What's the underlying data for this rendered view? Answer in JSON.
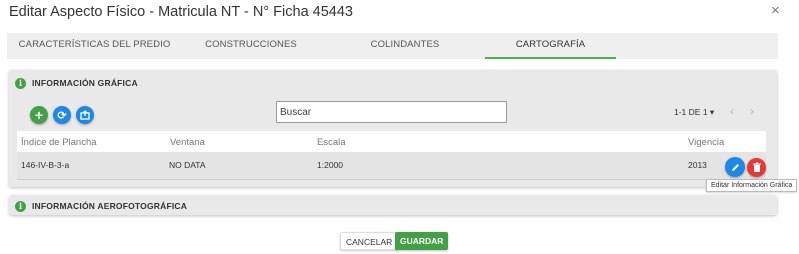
{
  "dialog": {
    "title": "Editar Aspecto Físico - Matricula NT - N° Ficha 45443",
    "close_icon": "×"
  },
  "tabs": [
    {
      "label": "Características del Predio",
      "active": false
    },
    {
      "label": "Construcciones",
      "active": false
    },
    {
      "label": "Colindantes",
      "active": false
    },
    {
      "label": "Cartografía",
      "active": true
    }
  ],
  "info_grafica": {
    "title": "INFORMACIÓN GRÁFICA",
    "info_icon": "i",
    "actions": {
      "add_icon": "+",
      "refresh_icon": "⟳",
      "upload_icon": "upload-icon"
    },
    "search": {
      "placeholder": "Buscar",
      "value": ""
    },
    "pagination": {
      "text": "1-1 DE 1",
      "dropdown_icon": "▾",
      "prev_icon": "‹",
      "next_icon": "›"
    },
    "columns": [
      "Índice de Plancha",
      "Ventana",
      "Escala",
      "Vigencia"
    ],
    "rows": [
      {
        "indice": "146-IV-B-3-a",
        "ventana": "NO DATA",
        "escala": "1:2000",
        "vigencia": "2013"
      }
    ],
    "tooltip": "Editar Información Gráfica"
  },
  "info_aerofotografica": {
    "title": "INFORMACIÓN AEROFOTOGRÁFICA",
    "info_icon": "i"
  },
  "footer": {
    "cancel_label": "CANCELAR",
    "save_label": "GUARDAR"
  },
  "colors": {
    "accent_green": "#43a047",
    "blue": "#1e88e5",
    "red": "#e53935"
  }
}
